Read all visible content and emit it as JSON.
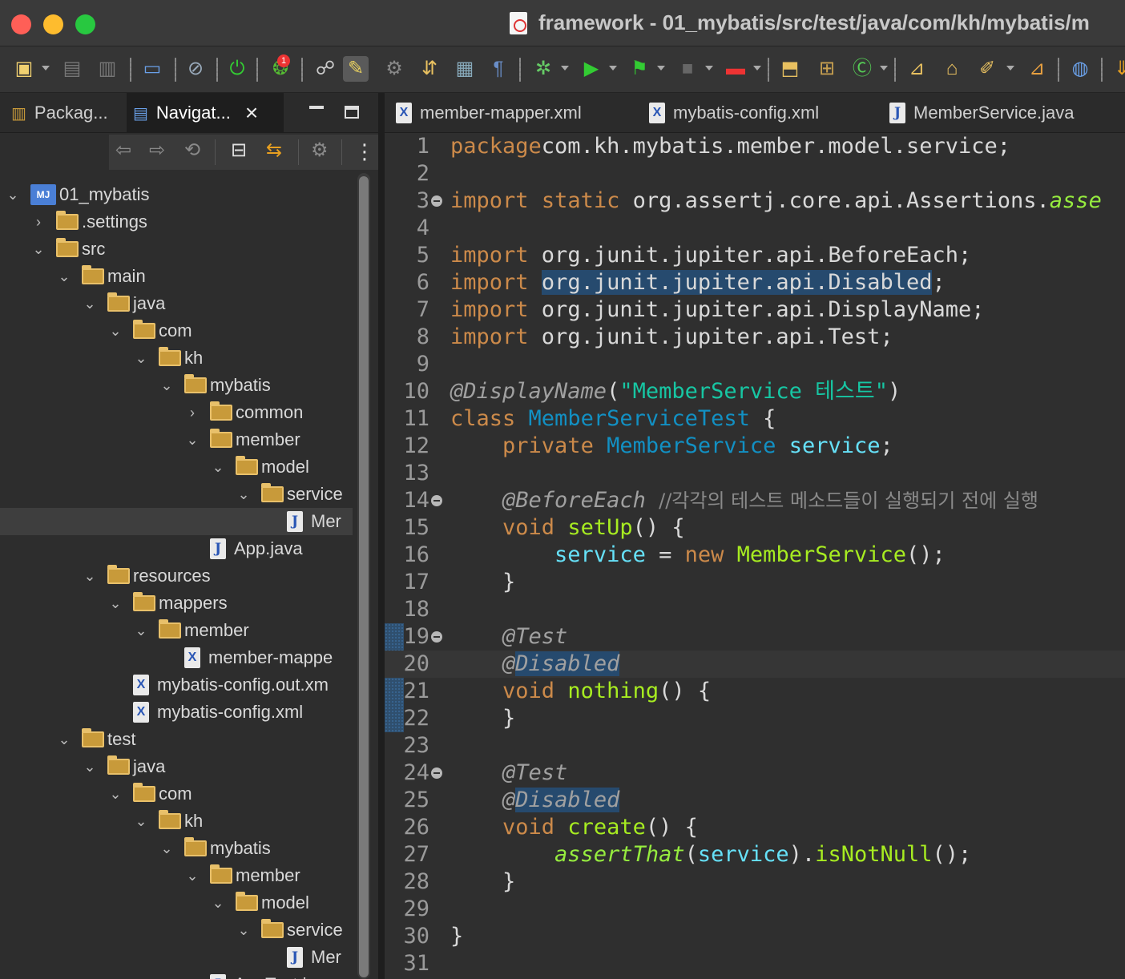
{
  "window": {
    "title": "framework - 01_mybatis/src/test/java/com/kh/mybatis/m"
  },
  "toolbar": {
    "badge_count": "1"
  },
  "left_panel": {
    "tabs": [
      {
        "label": "Packag..."
      },
      {
        "label": "Navigat..."
      }
    ],
    "tree": [
      {
        "label": "01_mybatis",
        "depth": 0,
        "kind": "project",
        "expanded": true
      },
      {
        "label": ".settings",
        "depth": 1,
        "kind": "folder",
        "expanded": false
      },
      {
        "label": "src",
        "depth": 1,
        "kind": "folder",
        "expanded": true
      },
      {
        "label": "main",
        "depth": 2,
        "kind": "folder",
        "expanded": true
      },
      {
        "label": "java",
        "depth": 3,
        "kind": "folder",
        "expanded": true
      },
      {
        "label": "com",
        "depth": 4,
        "kind": "folder",
        "expanded": true
      },
      {
        "label": "kh",
        "depth": 5,
        "kind": "folder",
        "expanded": true
      },
      {
        "label": "mybatis",
        "depth": 6,
        "kind": "folder",
        "expanded": true
      },
      {
        "label": "common",
        "depth": 7,
        "kind": "folder",
        "expanded": false
      },
      {
        "label": "member",
        "depth": 7,
        "kind": "folder",
        "expanded": true
      },
      {
        "label": "model",
        "depth": 8,
        "kind": "folder",
        "expanded": true
      },
      {
        "label": "service",
        "depth": 9,
        "kind": "folder",
        "expanded": true
      },
      {
        "label": "Mer",
        "depth": 10,
        "kind": "java",
        "selected": true
      },
      {
        "label": "App.java",
        "depth": 7,
        "kind": "java"
      },
      {
        "label": "resources",
        "depth": 3,
        "kind": "folder",
        "expanded": true
      },
      {
        "label": "mappers",
        "depth": 4,
        "kind": "folder",
        "expanded": true
      },
      {
        "label": "member",
        "depth": 5,
        "kind": "folder",
        "expanded": true
      },
      {
        "label": "member-mappe",
        "depth": 6,
        "kind": "xml"
      },
      {
        "label": "mybatis-config.out.xm",
        "depth": 4,
        "kind": "xml"
      },
      {
        "label": "mybatis-config.xml",
        "depth": 4,
        "kind": "xml"
      },
      {
        "label": "test",
        "depth": 2,
        "kind": "folder",
        "expanded": true
      },
      {
        "label": "java",
        "depth": 3,
        "kind": "folder",
        "expanded": true
      },
      {
        "label": "com",
        "depth": 4,
        "kind": "folder",
        "expanded": true
      },
      {
        "label": "kh",
        "depth": 5,
        "kind": "folder",
        "expanded": true
      },
      {
        "label": "mybatis",
        "depth": 6,
        "kind": "folder",
        "expanded": true
      },
      {
        "label": "member",
        "depth": 7,
        "kind": "folder",
        "expanded": true
      },
      {
        "label": "model",
        "depth": 8,
        "kind": "folder",
        "expanded": true
      },
      {
        "label": "service",
        "depth": 9,
        "kind": "folder",
        "expanded": true
      },
      {
        "label": "Mer",
        "depth": 10,
        "kind": "java"
      },
      {
        "label": "AppTest.java",
        "depth": 7,
        "kind": "java"
      }
    ]
  },
  "editor": {
    "tabs": [
      {
        "label": "member-mapper.xml",
        "kind": "xml"
      },
      {
        "label": "mybatis-config.xml",
        "kind": "xml"
      },
      {
        "label": "MemberService.java",
        "kind": "java"
      }
    ],
    "current_line": 20,
    "lines": [
      {
        "n": "1",
        "tokens": [
          [
            "kw",
            "package"
          ],
          [
            "",
            "com.kh.mybatis.member.model.service;"
          ]
        ]
      },
      {
        "n": "2",
        "tokens": []
      },
      {
        "n": "3",
        "fold": true,
        "tokens": [
          [
            "kw",
            "import"
          ],
          [
            "",
            " "
          ],
          [
            "kw",
            "static"
          ],
          [
            "",
            " org.assertj.core.api.Assertions."
          ],
          [
            "sm",
            "asse"
          ]
        ]
      },
      {
        "n": "4",
        "tokens": []
      },
      {
        "n": "5",
        "tokens": [
          [
            "kw",
            "import"
          ],
          [
            "",
            " org.junit.jupiter.api.BeforeEach;"
          ]
        ]
      },
      {
        "n": "6",
        "tokens": [
          [
            "kw",
            "import"
          ],
          [
            "",
            " "
          ],
          [
            "hl",
            "org.junit.jupiter.api.Disabled"
          ],
          [
            "",
            ";"
          ]
        ]
      },
      {
        "n": "7",
        "tokens": [
          [
            "kw",
            "import"
          ],
          [
            "",
            " org.junit.jupiter.api.DisplayName;"
          ]
        ]
      },
      {
        "n": "8",
        "tokens": [
          [
            "kw",
            "import"
          ],
          [
            "",
            " org.junit.jupiter.api.Test;"
          ]
        ]
      },
      {
        "n": "9",
        "tokens": []
      },
      {
        "n": "10",
        "tokens": [
          [
            "an",
            "@DisplayName"
          ],
          [
            "",
            "("
          ],
          [
            "str",
            "\"MemberService 테스트\""
          ],
          [
            "",
            ")"
          ]
        ]
      },
      {
        "n": "11",
        "tokens": [
          [
            "kw",
            "class"
          ],
          [
            "",
            " "
          ],
          [
            "ty",
            "MemberServiceTest"
          ],
          [
            "",
            " {"
          ]
        ]
      },
      {
        "n": "12",
        "tokens": [
          [
            "",
            "    "
          ],
          [
            "kw",
            "private"
          ],
          [
            "",
            " "
          ],
          [
            "ty",
            "MemberService"
          ],
          [
            "",
            " "
          ],
          [
            "fd",
            "service"
          ],
          [
            "",
            ";"
          ]
        ]
      },
      {
        "n": "13",
        "tokens": []
      },
      {
        "n": "14",
        "fold": true,
        "tokens": [
          [
            "",
            "    "
          ],
          [
            "an",
            "@BeforeEach"
          ],
          [
            "",
            " "
          ],
          [
            "cm",
            "//각각의 테스트 메소드들이 실행되기 전에 실행"
          ]
        ]
      },
      {
        "n": "15",
        "tokens": [
          [
            "",
            "    "
          ],
          [
            "kw",
            "void"
          ],
          [
            "",
            " "
          ],
          [
            "mt",
            "setUp"
          ],
          [
            "",
            "() {"
          ]
        ]
      },
      {
        "n": "16",
        "tokens": [
          [
            "",
            "        "
          ],
          [
            "fd",
            "service"
          ],
          [
            "",
            " = "
          ],
          [
            "kw",
            "new"
          ],
          [
            "",
            " "
          ],
          [
            "mt",
            "MemberService"
          ],
          [
            "",
            "();"
          ]
        ]
      },
      {
        "n": "17",
        "tokens": [
          [
            "",
            "    }"
          ]
        ]
      },
      {
        "n": "18",
        "tokens": []
      },
      {
        "n": "19",
        "fold": true,
        "tokens": [
          [
            "",
            "    "
          ],
          [
            "an",
            "@Test"
          ]
        ]
      },
      {
        "n": "20",
        "tokens": [
          [
            "",
            "    "
          ],
          [
            "an",
            "@"
          ],
          [
            "hl an",
            "Disabled"
          ]
        ]
      },
      {
        "n": "21",
        "tokens": [
          [
            "",
            "    "
          ],
          [
            "kw",
            "void"
          ],
          [
            "",
            " "
          ],
          [
            "mt",
            "nothing"
          ],
          [
            "",
            "() {"
          ]
        ]
      },
      {
        "n": "22",
        "tokens": [
          [
            "",
            "    }"
          ]
        ]
      },
      {
        "n": "23",
        "tokens": []
      },
      {
        "n": "24",
        "fold": true,
        "tokens": [
          [
            "",
            "    "
          ],
          [
            "an",
            "@Test"
          ]
        ]
      },
      {
        "n": "25",
        "tokens": [
          [
            "",
            "    "
          ],
          [
            "an",
            "@"
          ],
          [
            "hl an",
            "Disabled"
          ]
        ]
      },
      {
        "n": "26",
        "tokens": [
          [
            "",
            "    "
          ],
          [
            "kw",
            "void"
          ],
          [
            "",
            " "
          ],
          [
            "mt",
            "create"
          ],
          [
            "",
            "() {"
          ]
        ]
      },
      {
        "n": "27",
        "tokens": [
          [
            "",
            "        "
          ],
          [
            "sm",
            "assertThat"
          ],
          [
            "",
            "("
          ],
          [
            "fd",
            "service"
          ],
          [
            "",
            ")."
          ],
          [
            "mt",
            "isNotNull"
          ],
          [
            "",
            "();"
          ]
        ]
      },
      {
        "n": "28",
        "tokens": [
          [
            "",
            "    }"
          ]
        ]
      },
      {
        "n": "29",
        "tokens": []
      },
      {
        "n": "30",
        "tokens": [
          [
            "",
            "}"
          ]
        ]
      },
      {
        "n": "31",
        "tokens": []
      }
    ]
  }
}
